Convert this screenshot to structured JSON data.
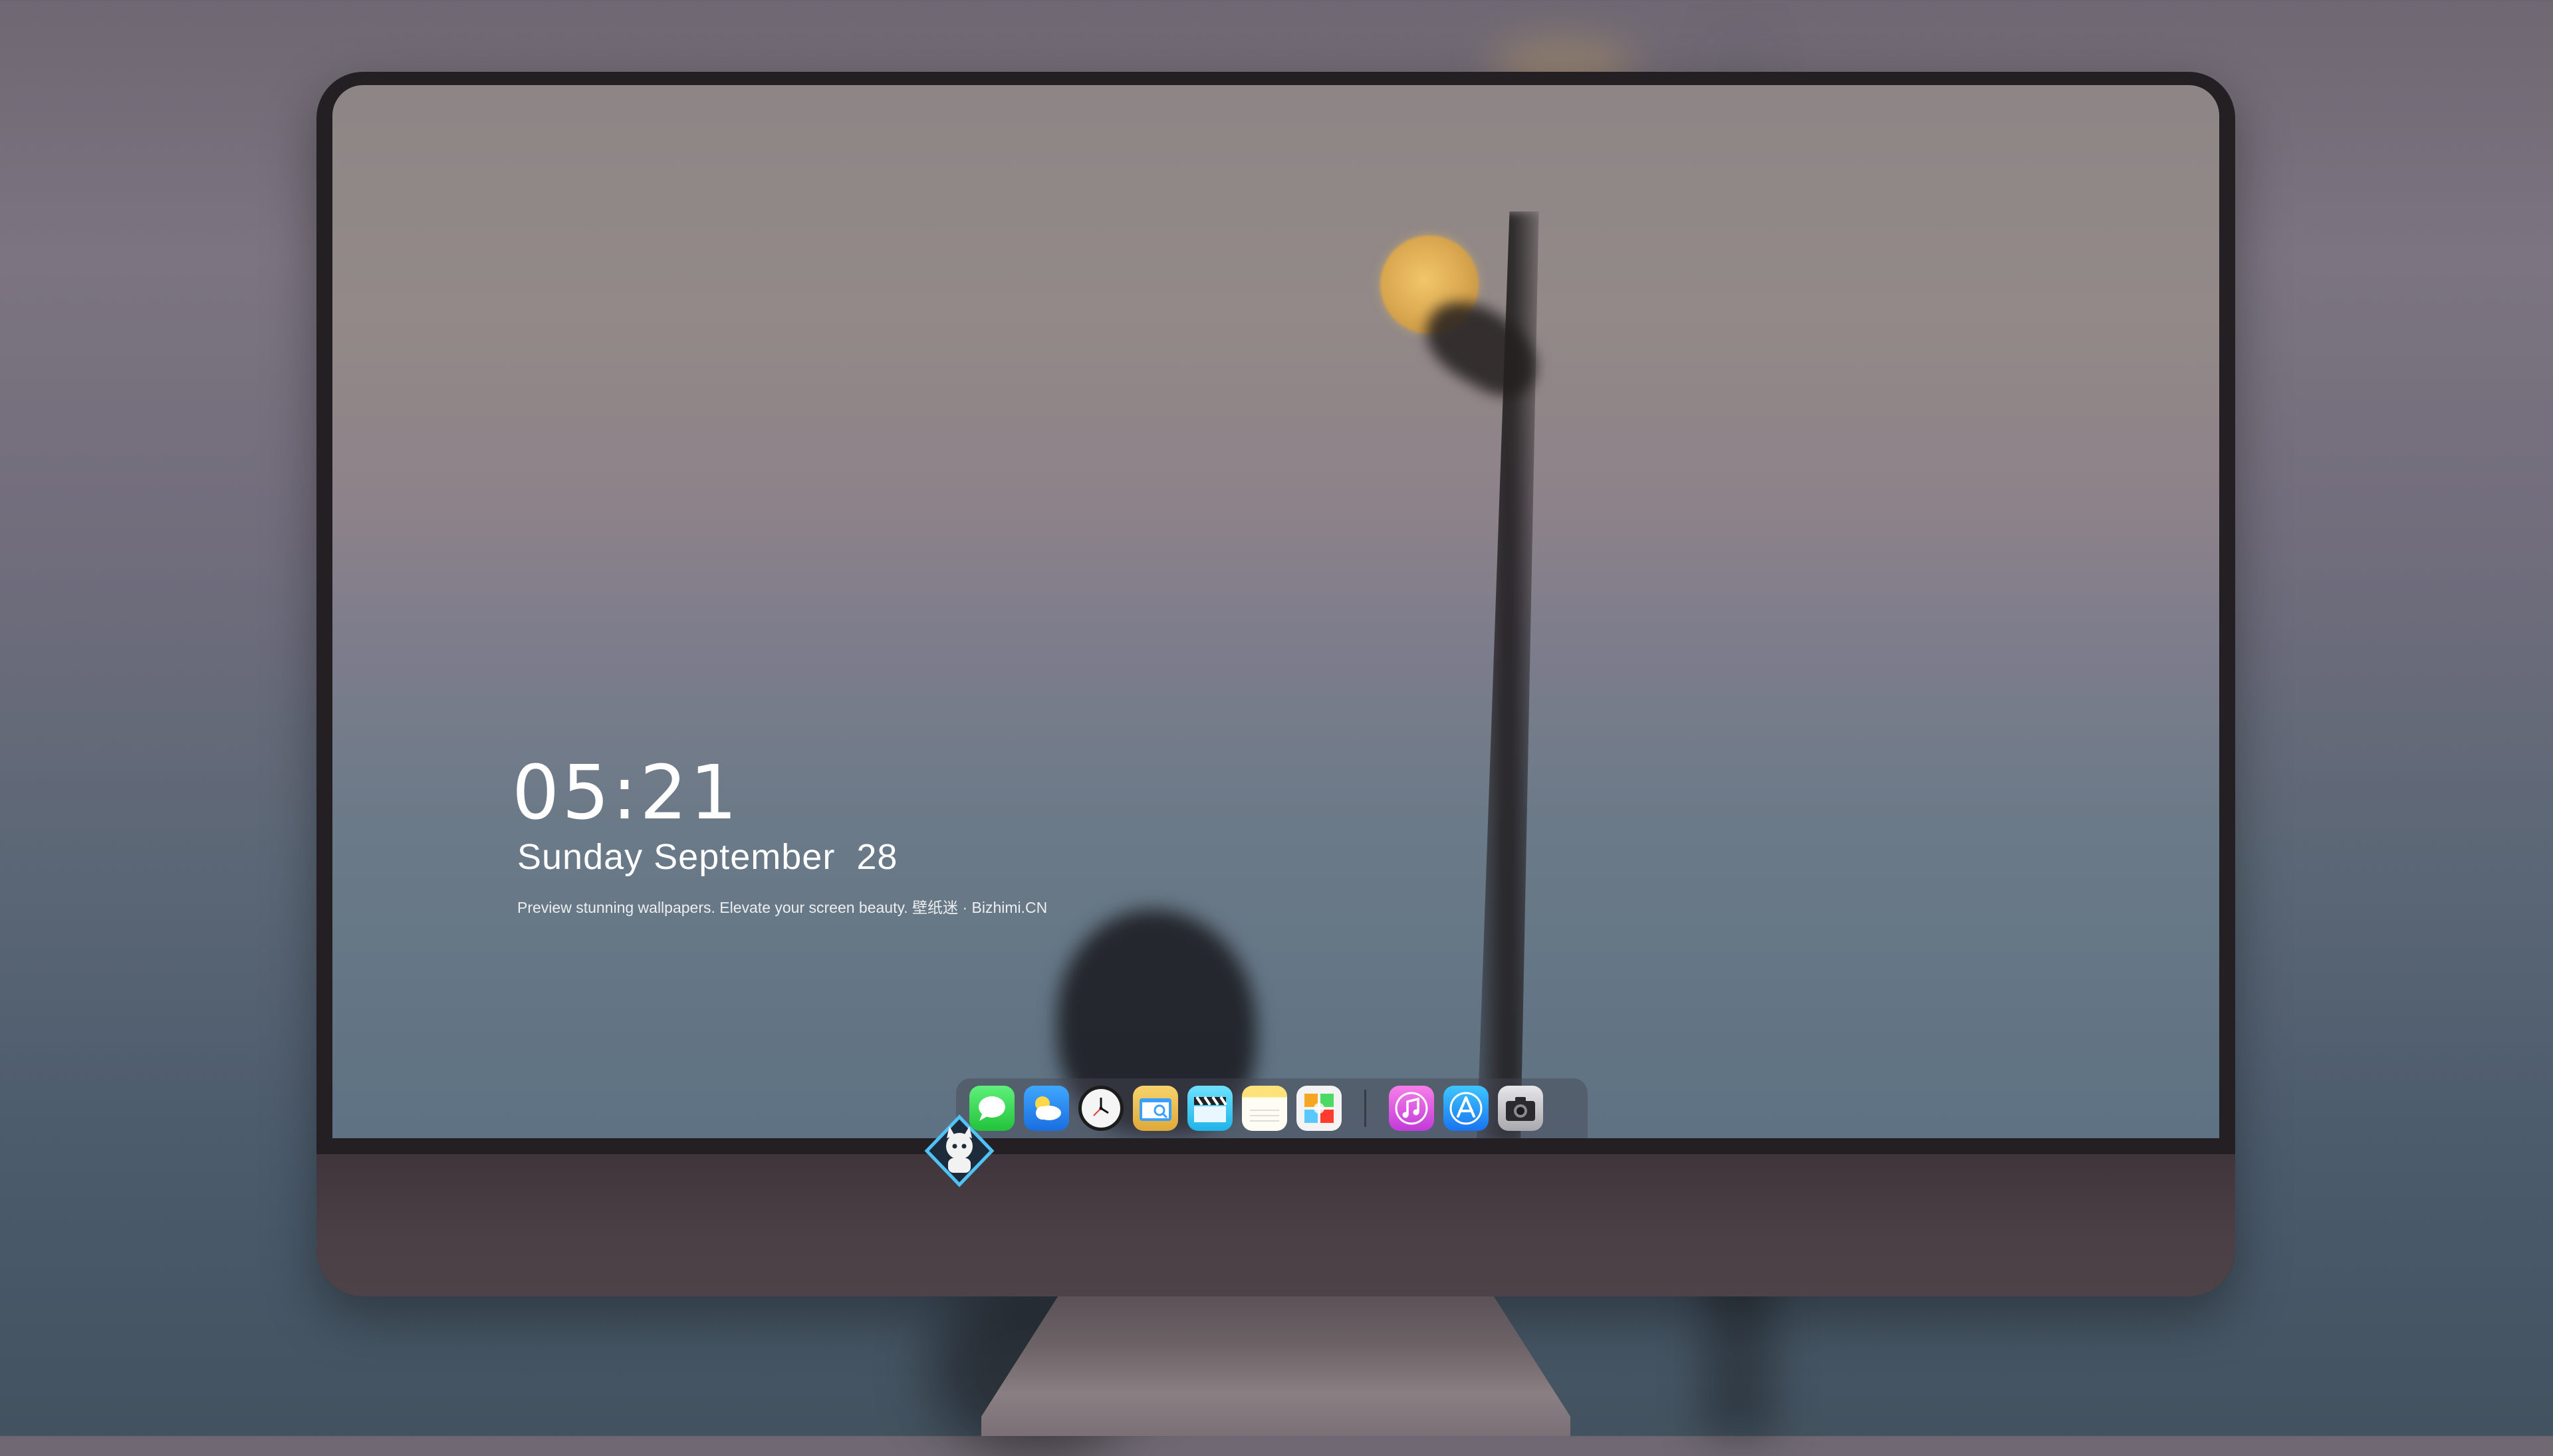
{
  "lockscreen": {
    "time": "05:21",
    "date_weekday_month": "Sunday September",
    "date_day": "28",
    "tagline": "Preview stunning wallpapers. Elevate your screen beauty. 壁纸迷 · Bizhimi.CN"
  },
  "dock": {
    "apps": [
      {
        "name": "messages-icon"
      },
      {
        "name": "weather-icon"
      },
      {
        "name": "clock-icon"
      },
      {
        "name": "finder-icon"
      },
      {
        "name": "clips-icon"
      },
      {
        "name": "notes-icon"
      },
      {
        "name": "photos-icon"
      },
      {
        "name": "music-icon"
      },
      {
        "name": "app-store-icon"
      },
      {
        "name": "camera-icon"
      }
    ]
  },
  "monitor": {
    "brand_logo": "bizhimi-logo-icon"
  },
  "colors": {
    "clock_text": "#ffffff",
    "monitor_bezel": "#231f22",
    "moon": "#e6b55a"
  }
}
